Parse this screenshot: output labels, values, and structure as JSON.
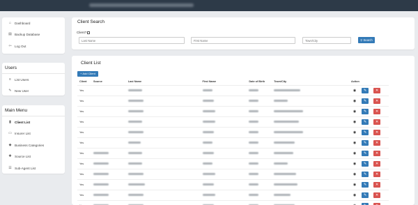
{
  "sidebar": {
    "top_items": [
      {
        "label": "Dashboard",
        "icon": "home-icon"
      },
      {
        "label": "Backup Database",
        "icon": "database-icon"
      },
      {
        "label": "Log Out",
        "icon": "logout-icon"
      }
    ],
    "users": {
      "title": "Users",
      "items": [
        {
          "label": "List Users",
          "icon": "list-icon"
        },
        {
          "label": "New User",
          "icon": "edit-icon"
        }
      ]
    },
    "main_menu": {
      "title": "Main Menu",
      "items": [
        {
          "label": "Client List",
          "icon": "file-icon"
        },
        {
          "label": "Insurer List",
          "icon": "card-icon"
        },
        {
          "label": "Business Categories",
          "icon": "tag-icon"
        },
        {
          "label": "Source List",
          "icon": "gear-icon"
        },
        {
          "label": "Sub-Agent List",
          "icon": "user-list-icon"
        }
      ]
    }
  },
  "search": {
    "title": "Client Search",
    "client_label": "Client?",
    "last_name_placeholder": "Last Name",
    "first_name_placeholder": "First Name",
    "town_placeholder": "Town/City",
    "button_label": "Search"
  },
  "client_list": {
    "title": "Client List",
    "add_button_label": "+ Add Client",
    "columns": [
      "Client",
      "Source",
      "Last Name",
      "First Name",
      "Date of Birth",
      "Town/City",
      "Action"
    ],
    "rows": [
      "Yes",
      "Yes",
      "Yes",
      "Yes",
      "Yes",
      "Yes",
      "Yes",
      "Yes",
      "Yes",
      "Yes",
      "Yes",
      "Yes"
    ]
  }
}
